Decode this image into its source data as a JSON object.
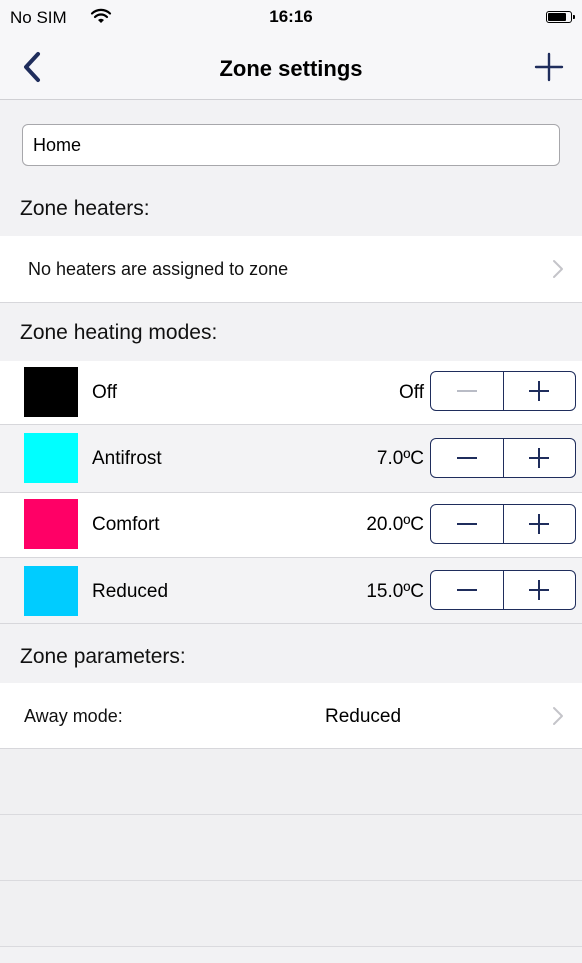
{
  "status_bar": {
    "carrier": "No SIM",
    "time": "16:16"
  },
  "nav": {
    "title": "Zone settings",
    "back_icon": "chevron-left-icon",
    "add_icon": "plus-icon"
  },
  "zone_name": {
    "value": "Home"
  },
  "sections": {
    "heaters": "Zone heaters:",
    "modes": "Zone heating modes:",
    "parameters": "Zone parameters:"
  },
  "heaters_row": {
    "label": "No heaters are assigned to zone"
  },
  "modes": [
    {
      "name": "Off",
      "value": "Off",
      "color": "#000000",
      "minus_enabled": false
    },
    {
      "name": "Antifrost",
      "value": "7.0ºC",
      "color": "#00ffff",
      "minus_enabled": true
    },
    {
      "name": "Comfort",
      "value": "20.0ºC",
      "color": "#ff0066",
      "minus_enabled": true
    },
    {
      "name": "Reduced",
      "value": "15.0ºC",
      "color": "#00ccff",
      "minus_enabled": true
    }
  ],
  "away_mode": {
    "label": "Away mode:",
    "value": "Reduced"
  },
  "colors": {
    "accent": "#1f2d5c"
  }
}
